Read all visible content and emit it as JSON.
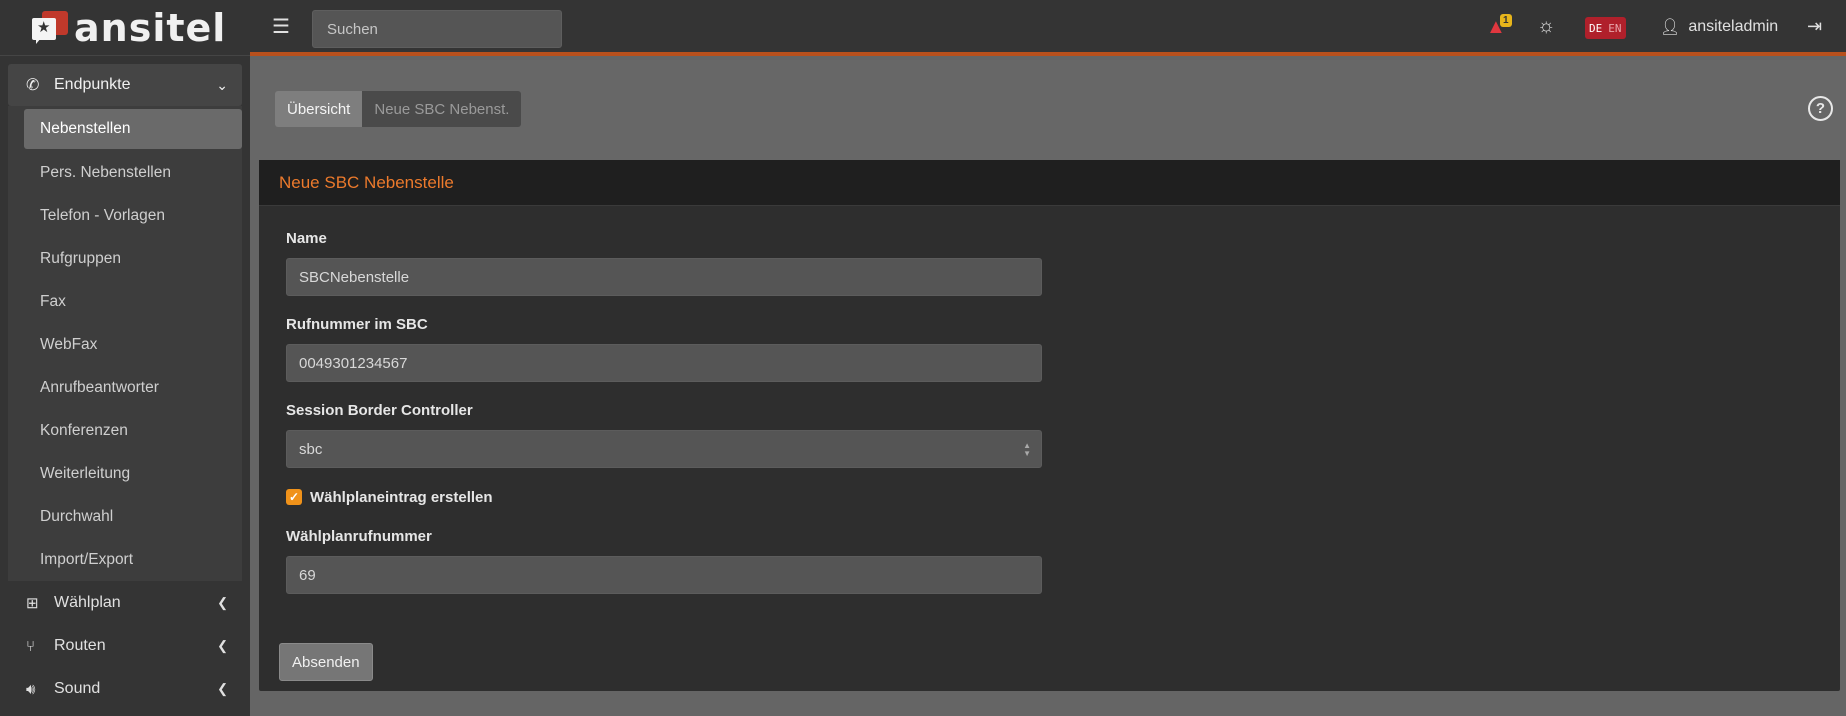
{
  "app": {
    "brand_name": "ansitel"
  },
  "sidebar": {
    "group": {
      "label": "Endpunkte",
      "icon": "phone-icon",
      "items": [
        {
          "label": "Nebenstellen",
          "active": true
        },
        {
          "label": "Pers. Nebenstellen"
        },
        {
          "label": "Telefon - Vorlagen"
        },
        {
          "label": "Rufgruppen"
        },
        {
          "label": "Fax"
        },
        {
          "label": "WebFax"
        },
        {
          "label": "Anrufbeantworter"
        },
        {
          "label": "Konferenzen"
        },
        {
          "label": "Weiterleitung"
        },
        {
          "label": "Durchwahl"
        },
        {
          "label": "Import/Export"
        }
      ]
    },
    "items": [
      {
        "label": "Wählplan",
        "icon": "sitemap-icon"
      },
      {
        "label": "Routen",
        "icon": "branch-icon"
      },
      {
        "label": "Sound",
        "icon": "volume-icon"
      }
    ]
  },
  "topbar": {
    "search_placeholder": "Suchen",
    "alert_count": "1",
    "lang_de": "DE",
    "lang_en": "EN",
    "username": "ansiteladmin"
  },
  "breadcrumbs": {
    "first": "Übersicht",
    "second": "Neue SBC Nebenst."
  },
  "card": {
    "title": "Neue SBC Nebenstelle"
  },
  "form": {
    "name_label": "Name",
    "name_value": "SBCNebenstelle",
    "number_label": "Rufnummer im SBC",
    "number_value": "0049301234567",
    "sbc_label": "Session Border Controller",
    "sbc_value": "sbc",
    "checkbox_label": "Wählplaneintrag erstellen",
    "checkbox_checked": true,
    "dialplan_label": "Wählplanrufnummer",
    "dialplan_value": "69",
    "submit_label": "Absenden"
  },
  "colors": {
    "accent_orange": "#ec7a2c",
    "topbar_border": "#b8501c",
    "alert_red": "#e0373f",
    "lang_badge": "#b0202b",
    "checkbox": "#f0921a"
  }
}
